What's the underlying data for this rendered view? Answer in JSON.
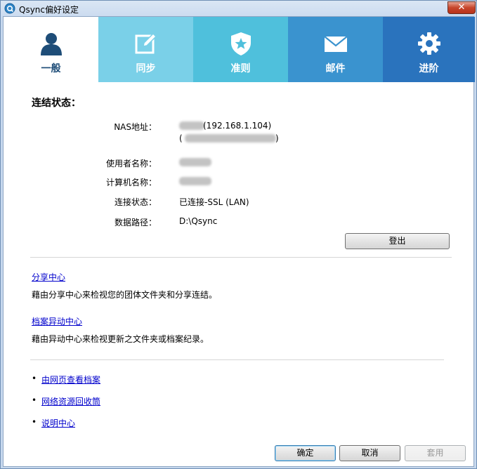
{
  "window": {
    "title": "Qsync偏好设定",
    "close_glyph": "✕"
  },
  "tabs": [
    {
      "label": "一般",
      "icon": "user-icon",
      "color": "#ffffff",
      "active": true
    },
    {
      "label": "同步",
      "icon": "edit-icon",
      "color": "#7ad0e8"
    },
    {
      "label": "准则",
      "icon": "shield-icon",
      "color": "#4fc0dc"
    },
    {
      "label": "邮件",
      "icon": "mail-icon",
      "color": "#3a93cf"
    },
    {
      "label": "进阶",
      "icon": "gear-icon",
      "color": "#2a73bd"
    }
  ],
  "connection": {
    "section_title": "连结状态：",
    "nas_label": "NAS地址：",
    "nas_value": "(192.168.1.104)",
    "nas_value_line2_suffix": ")",
    "user_label": "使用者名称：",
    "computer_label": "计算机名称：",
    "status_label": "连接状态：",
    "status_value": "已连接-SSL (LAN)",
    "path_label": "数据路径：",
    "path_value": "D:\\Qsync",
    "logout_button": "登出"
  },
  "share_center": {
    "link": "分享中心",
    "description": "藉由分享中心来检视您的团体文件夹和分享连结。"
  },
  "change_center": {
    "link": "档案异动中心",
    "description": "藉由异动中心来检视更新之文件夹或档案纪录。"
  },
  "links": [
    {
      "bullet": "•",
      "label": "由网页查看档案"
    },
    {
      "bullet": "•",
      "label": "网络资源回收筒"
    },
    {
      "bullet": "•",
      "label": "说明中心"
    }
  ],
  "footer": {
    "ok": "确定",
    "cancel": "取消",
    "apply": "套用"
  }
}
